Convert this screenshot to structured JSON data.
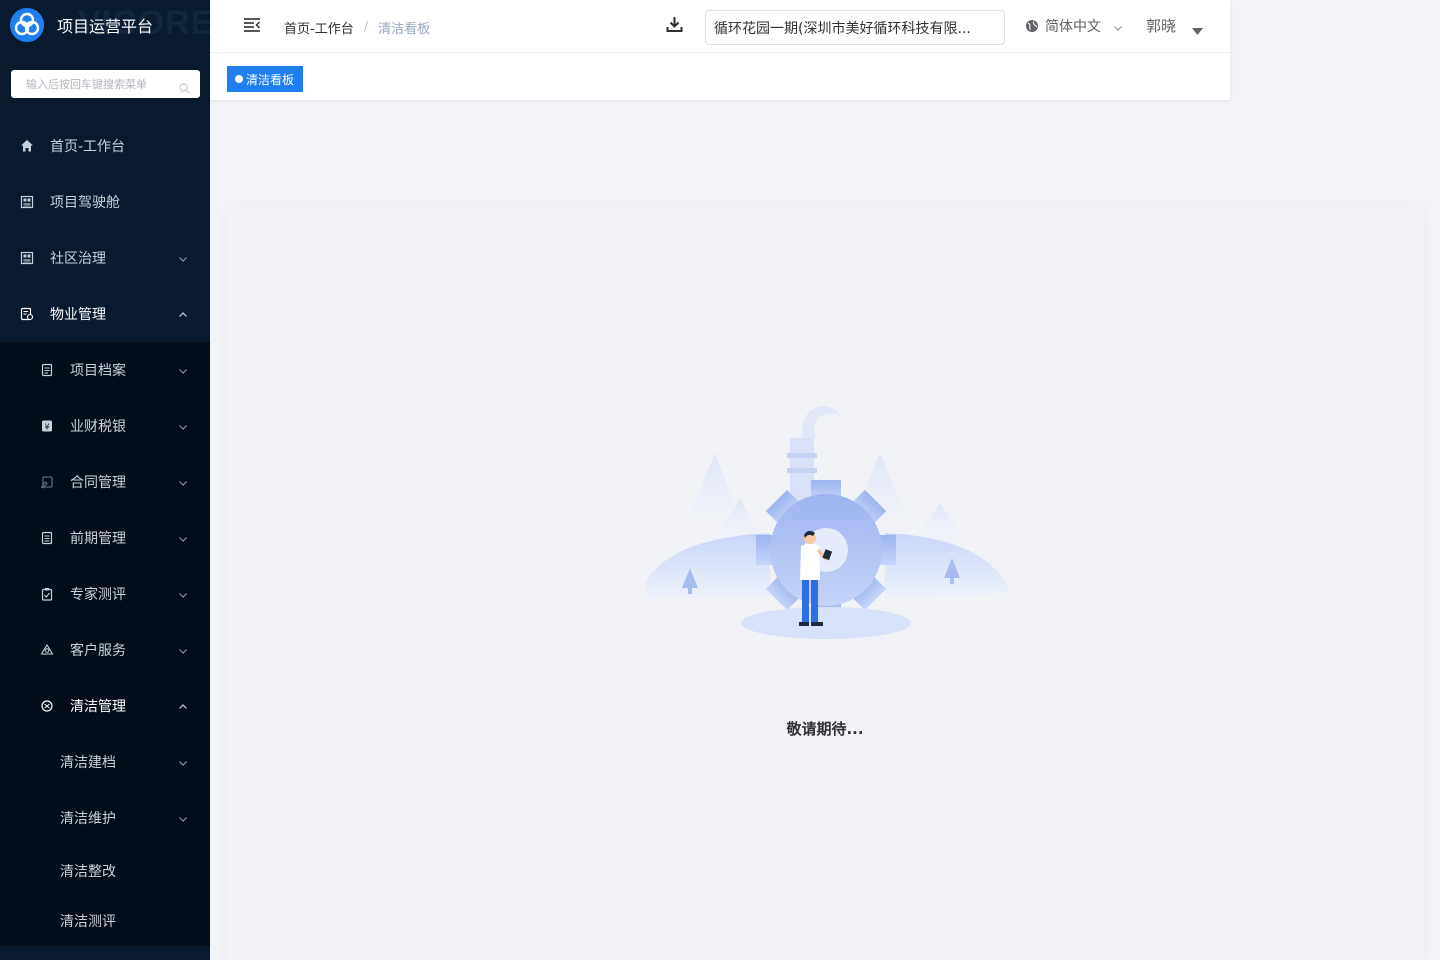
{
  "app": {
    "title": "项目运营平台",
    "watermark": "VICORE"
  },
  "sidebar": {
    "search_placeholder": "输入后按回车键搜索菜单",
    "items": [
      {
        "label": "首页-工作台",
        "icon": "home-icon"
      },
      {
        "label": "项目驾驶舱",
        "icon": "grid-icon"
      },
      {
        "label": "社区治理",
        "icon": "grid-icon",
        "expandable": true
      },
      {
        "label": "物业管理",
        "icon": "property-icon",
        "expandable": true,
        "expanded": true
      }
    ],
    "property_children": [
      {
        "label": "项目档案",
        "icon": "file-icon"
      },
      {
        "label": "业财税银",
        "icon": "finance-icon"
      },
      {
        "label": "合同管理",
        "icon": "contract-icon"
      },
      {
        "label": "前期管理",
        "icon": "doc-icon"
      },
      {
        "label": "专家测评",
        "icon": "clipboard-icon"
      },
      {
        "label": "客户服务",
        "icon": "service-icon"
      },
      {
        "label": "清洁管理",
        "icon": "clean-icon",
        "expanded": true
      }
    ],
    "cleaning_children": [
      {
        "label": "清洁建档",
        "expandable": true
      },
      {
        "label": "清洁维护",
        "expandable": true
      },
      {
        "label": "清洁整改"
      },
      {
        "label": "清洁测评"
      }
    ]
  },
  "header": {
    "breadcrumb": [
      "首页-工作台",
      "清洁看板"
    ],
    "breadcrumb_separator": "/",
    "project_select": "循环花园一期(深圳市美好循环科技有限...",
    "language": "简体中文",
    "user": "郭晓"
  },
  "tags": {
    "active": "清洁看板"
  },
  "main": {
    "message": "敬请期待..."
  },
  "colors": {
    "sidebar_bg": "#0a1a2e",
    "submenu_bg": "#030d19",
    "accent": "#1f7ff0"
  }
}
